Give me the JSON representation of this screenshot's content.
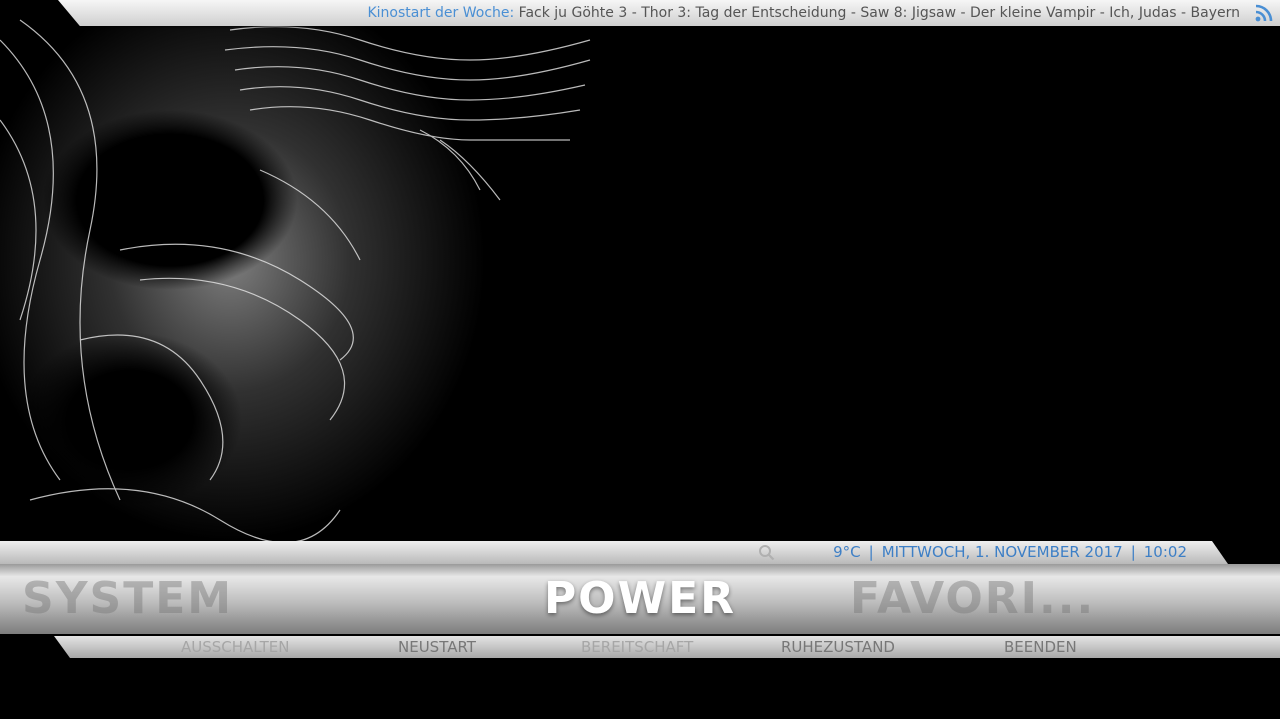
{
  "ticker": {
    "label": "Kinostart der Woche:",
    "text": " Fack ju Göhte 3 - Thor 3: Tag der Entscheidung - Saw 8: Jigsaw - Der kleine Vampir - Ich, Judas - Bayern",
    "icon": "rss-icon"
  },
  "info": {
    "icon": "search-icon",
    "temperature": "9°C",
    "date": "MITTWOCH, 1. NOVEMBER 2017",
    "time": "10:02",
    "separator": "|"
  },
  "main_menu": {
    "previous": "SYSTEM",
    "current": "POWER",
    "next": "FAVORI..."
  },
  "submenu": [
    {
      "label": "AUSSCHALTEN",
      "dim": true
    },
    {
      "label": "NEUSTART",
      "dim": false
    },
    {
      "label": "BEREITSCHAFT",
      "dim": true
    },
    {
      "label": "RUHEZUSTAND",
      "dim": false
    },
    {
      "label": "BEENDEN",
      "dim": false
    }
  ],
  "colors": {
    "accent": "#4a8fd4",
    "background": "#000000"
  }
}
